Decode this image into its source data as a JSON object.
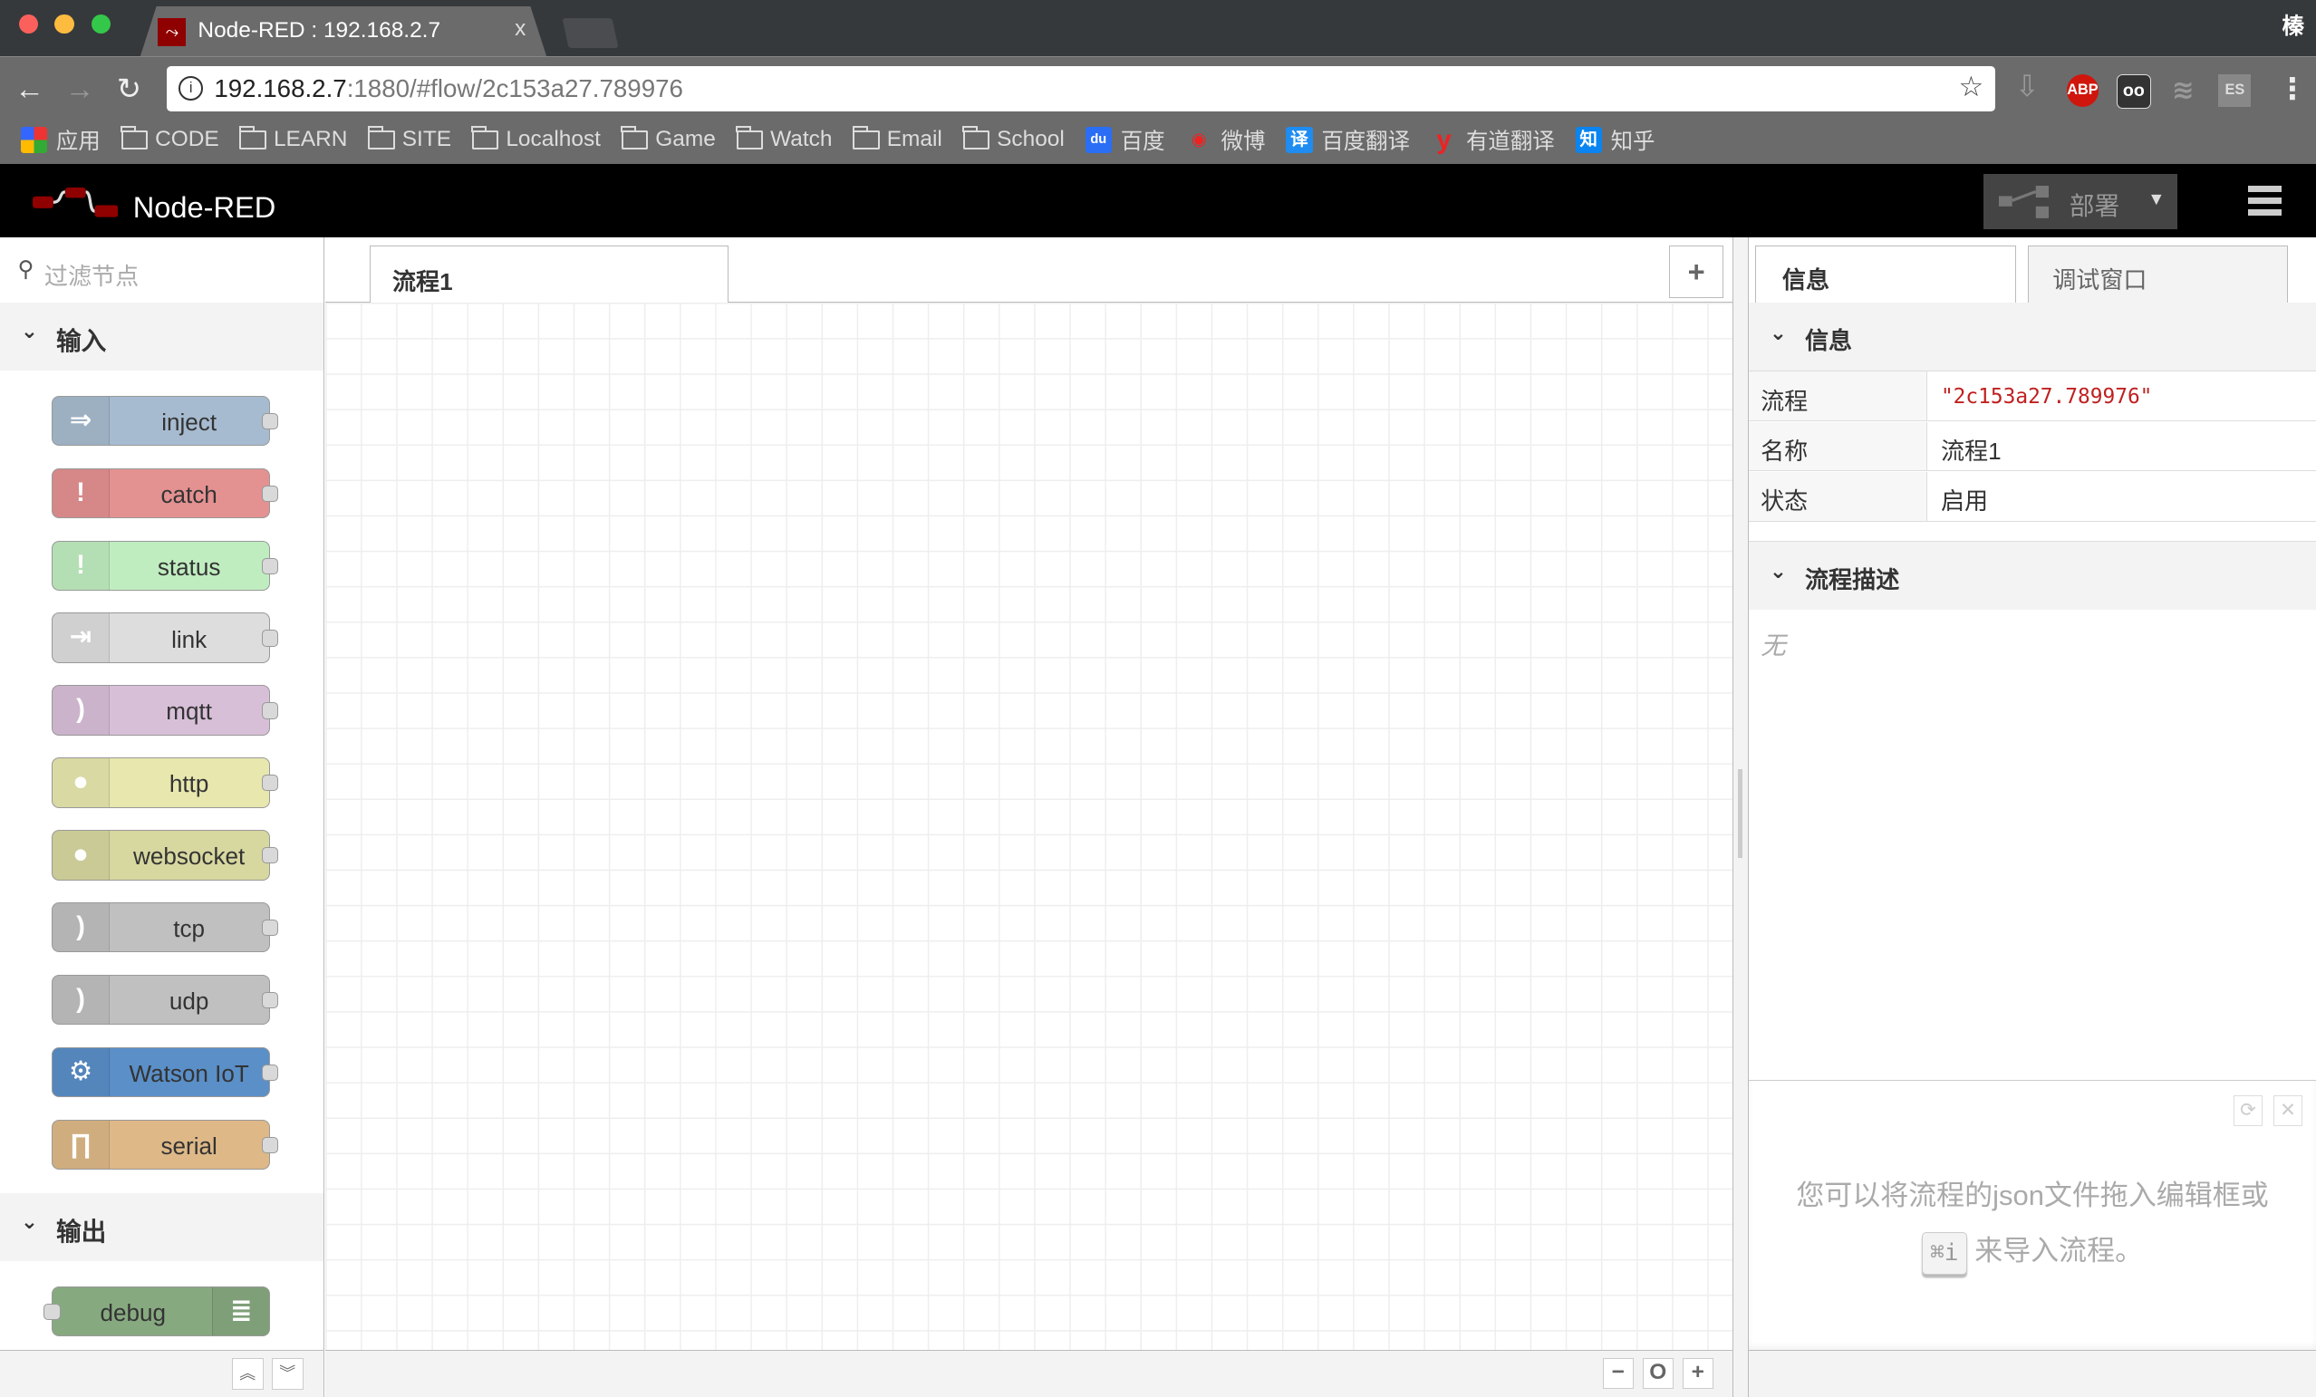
{
  "browser": {
    "tab_title": "Node-RED : 192.168.2.7",
    "tab_close": "x",
    "user_label": "榛",
    "url_host": "192.168.2.7",
    "url_rest": ":1880/#flow/2c153a27.789976",
    "bookmarks": [
      {
        "label": "应用",
        "icon": "apps-grid-icon"
      },
      {
        "label": "CODE",
        "icon": "folder-icon"
      },
      {
        "label": "LEARN",
        "icon": "folder-icon"
      },
      {
        "label": "SITE",
        "icon": "folder-icon"
      },
      {
        "label": "Localhost",
        "icon": "folder-icon"
      },
      {
        "label": "Game",
        "icon": "folder-icon"
      },
      {
        "label": "Watch",
        "icon": "folder-icon"
      },
      {
        "label": "Email",
        "icon": "folder-icon"
      },
      {
        "label": "School",
        "icon": "folder-icon"
      },
      {
        "label": "百度",
        "icon": "baidu-icon"
      },
      {
        "label": "微博",
        "icon": "weibo-icon"
      },
      {
        "label": "百度翻译",
        "icon": "baidu-translate-icon",
        "glyph": "译"
      },
      {
        "label": "有道翻译",
        "icon": "youdao-icon",
        "glyph": "y"
      },
      {
        "label": "知乎",
        "icon": "zhihu-icon",
        "glyph": "知"
      }
    ],
    "extensions": {
      "abp": "ABP",
      "es": "ES"
    }
  },
  "app": {
    "title": "Node-RED",
    "deploy_label": "部署"
  },
  "palette": {
    "filter_placeholder": "过滤节点",
    "categories": [
      {
        "label": "输入",
        "nodes": [
          {
            "label": "inject",
            "color": "#a6bbcf",
            "icon": "arrow-in-icon",
            "glyph": "⇒"
          },
          {
            "label": "catch",
            "color": "#e49191",
            "icon": "alert-icon",
            "glyph": "!"
          },
          {
            "label": "status",
            "color": "#c0edc0",
            "icon": "alert-icon",
            "glyph": "!"
          },
          {
            "label": "link",
            "color": "#dddddd",
            "icon": "link-icon",
            "glyph": "⇥"
          },
          {
            "label": "mqtt",
            "color": "#d8bfd8",
            "icon": "bridge-icon",
            "glyph": ")"
          },
          {
            "label": "http",
            "color": "#e7e7ae",
            "icon": "globe-icon",
            "glyph": "●"
          },
          {
            "label": "websocket",
            "color": "#d7d7a0",
            "icon": "globe-icon",
            "glyph": "●"
          },
          {
            "label": "tcp",
            "color": "#c0c0c0",
            "icon": "bridge-icon",
            "glyph": ")"
          },
          {
            "label": "udp",
            "color": "#c0c0c0",
            "icon": "bridge-icon",
            "glyph": ")"
          },
          {
            "label": "Watson IoT",
            "color": "#5a8fc8",
            "icon": "watson-icon",
            "glyph": "⚙"
          },
          {
            "label": "serial",
            "color": "#deb887",
            "icon": "serial-icon",
            "glyph": "∏"
          }
        ]
      },
      {
        "label": "输出",
        "nodes": [
          {
            "label": "debug",
            "color": "#87a980",
            "icon": "debug-icon",
            "glyph": "≣"
          }
        ]
      }
    ]
  },
  "workspace": {
    "tab_label": "流程1",
    "add_label": "+",
    "zoom_out": "−",
    "zoom_reset": "O",
    "zoom_in": "+"
  },
  "sidebar": {
    "tabs": [
      "信息",
      "调试窗口"
    ],
    "info_section": "信息",
    "rows": [
      {
        "key": "流程",
        "value": "\"2c153a27.789976\""
      },
      {
        "key": "名称",
        "value": "流程1"
      },
      {
        "key": "状态",
        "value": "启用"
      }
    ],
    "desc_section": "流程描述",
    "desc_value": "无",
    "help_line1": "您可以将流程的json文件拖入编辑框或",
    "help_key": "⌘i",
    "help_line2": "来导入流程。",
    "accent_red": "#c02020"
  }
}
